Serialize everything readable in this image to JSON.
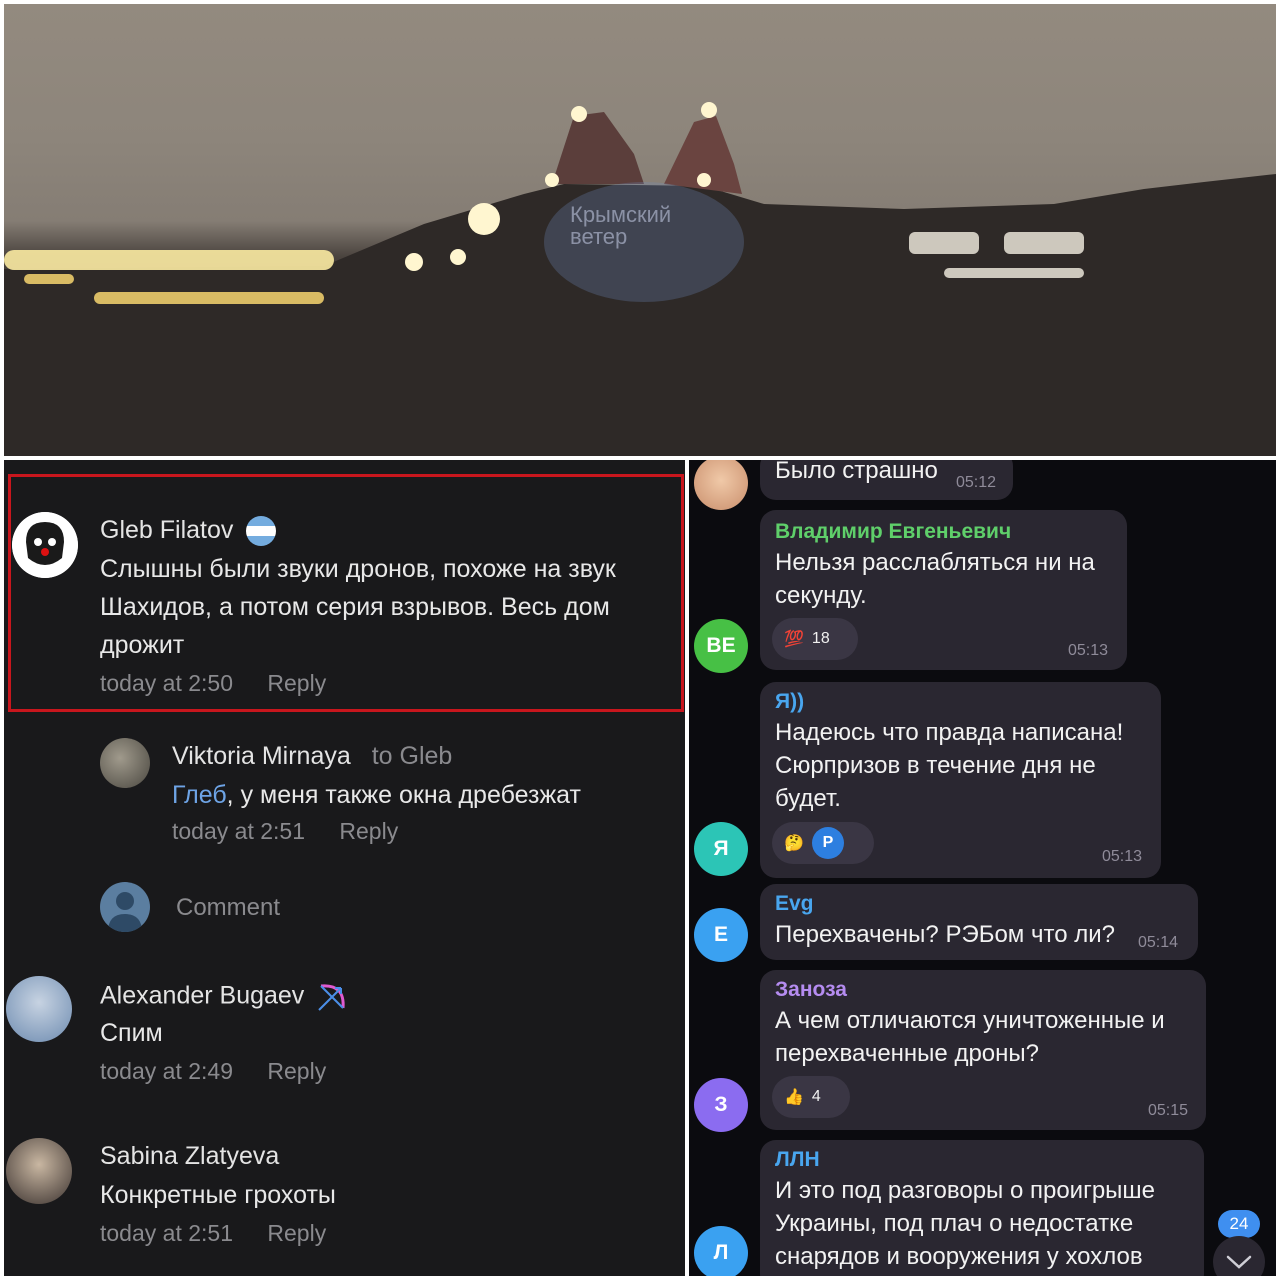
{
  "photo": {
    "watermark_line1": "Крымский",
    "watermark_line2": "ветер"
  },
  "vk": {
    "comments": [
      {
        "name": "Gleb Filatov",
        "badge_icon": "argentina-flag-icon",
        "text_lines": [
          "Слышны были звуки дронов, похоже на звук",
          "Шахидов, а потом серия взрывов. Весь дом",
          "дрожит"
        ],
        "time": "today at 2:50",
        "reply": "Reply"
      },
      {
        "name": "Viktoria Mirnaya",
        "to": "to Gleb",
        "mention": "Глеб",
        "text": ", у меня также окна дребезжат",
        "time": "today at 2:51",
        "reply": "Reply"
      },
      {
        "name": "Alexander Bugaev",
        "badge_icon": "bow-arrow-icon",
        "text": "Спим",
        "time": "today at 2:49",
        "reply": "Reply"
      },
      {
        "name": "Sabina Zlatyeva",
        "text": "Конкретные грохоты",
        "time": "today at 2:51",
        "reply": "Reply"
      }
    ],
    "comment_placeholder": "Comment"
  },
  "tg": {
    "messages": [
      {
        "text": "Было страшно",
        "time": "05:12"
      },
      {
        "sender": "Владимир Евгеньевич",
        "sender_color": "#5fcf6a",
        "lines": [
          "Нельзя расслабляться ни на",
          "секунду."
        ],
        "reaction": "💯",
        "reaction_count": "18",
        "time": "05:13",
        "avatar": "BE",
        "avatar_color": "#47c045"
      },
      {
        "sender": "Я))",
        "sender_color": "#49a6ef",
        "lines": [
          "Надеюсь что правда написана!",
          "Сюрпризов в течение дня не",
          "будет."
        ],
        "reaction": "🤔",
        "reaction_avatar": "P",
        "time": "05:13",
        "avatar": "Я",
        "avatar_color": "#2cc5b6"
      },
      {
        "sender": "Evg",
        "sender_color": "#49a6ef",
        "lines": [
          "Перехвачены? РЭБом что ли?"
        ],
        "time": "05:14",
        "avatar": "E",
        "avatar_color": "#3aa1f1"
      },
      {
        "sender": "Заноза",
        "sender_color": "#b58cf0",
        "lines": [
          "А чем отличаются уничтоженные и",
          "перехваченные дроны?"
        ],
        "reaction": "👍",
        "reaction_count": "4",
        "time": "05:15",
        "avatar": "З",
        "avatar_color": "#8b6cf0"
      },
      {
        "sender": "ЛЛН",
        "sender_color": "#49a6ef",
        "lines": [
          "И это под разговоры о проигрыше",
          "Украины, под плач о недостатке",
          "снарядов и вооружения у хохлов"
        ],
        "avatar": "Л",
        "avatar_color": "#3aa1f1"
      }
    ],
    "unread_badge": "24"
  }
}
